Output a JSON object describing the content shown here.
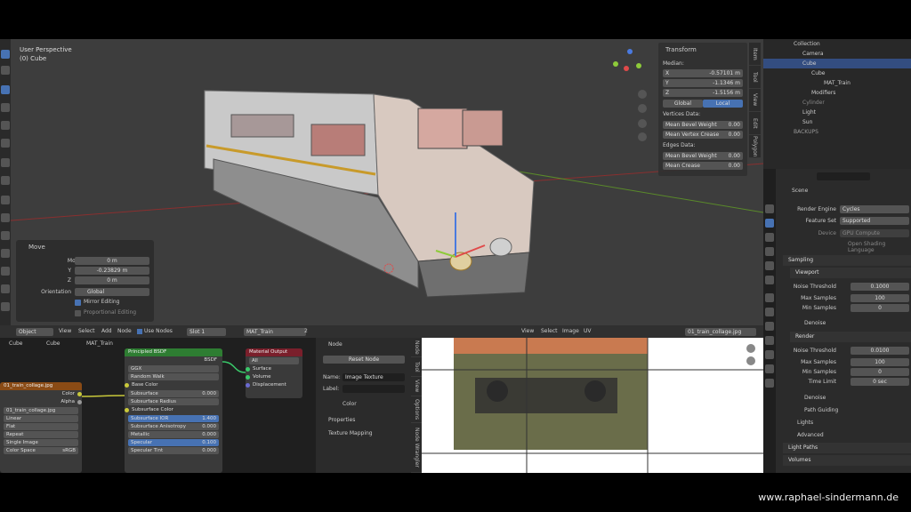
{
  "watermark": "www.raphael-sindermann.de",
  "viewport": {
    "title": "User Perspective",
    "subtitle": "(0) Cube"
  },
  "transform_panel": {
    "title": "Transform",
    "median_label": "Median:",
    "x_label": "X",
    "x_value": "-0.57101 m",
    "y_label": "Y",
    "y_value": "-1.1346 m",
    "z_label": "Z",
    "z_value": "-1.5156 m",
    "global_btn": "Global",
    "local_btn": "Local",
    "vertices_data": "Vertices Data:",
    "mean_bevel_weight_v": "Mean Bevel Weight",
    "mean_bevel_weight_v_val": "0.00",
    "mean_vertex_crease": "Mean Vertex Crease",
    "mean_vertex_crease_val": "0.00",
    "edges_data": "Edges Data:",
    "mean_bevel_weight_e": "Mean Bevel Weight",
    "mean_bevel_weight_e_val": "0.00",
    "mean_crease": "Mean Crease",
    "mean_crease_val": "0.00"
  },
  "npanel_tabs": [
    "Item",
    "Tool",
    "View",
    "Edit",
    "Polygon"
  ],
  "move_panel": {
    "title": "Move",
    "move_x_label": "Move X",
    "move_x": "0 m",
    "y_label": "Y",
    "y": "-0.23829 m",
    "z_label": "Z",
    "z": "0 m",
    "orientation_label": "Orientation",
    "orientation": "Global",
    "mirror_editing": "Mirror Editing",
    "proportional_editing": "Proportional Editing"
  },
  "outliner": {
    "collection": "Collection",
    "camera": "Camera",
    "cube": "Cube",
    "cube_mesh": "Cube",
    "mat_train": "MAT_Train",
    "modifiers": "Modifiers",
    "cylinder": "Cylinder",
    "light": "Light",
    "sun": "Sun",
    "backups": "BACKUPS"
  },
  "properties": {
    "scene": "Scene",
    "render_engine_label": "Render Engine",
    "render_engine": "Cycles",
    "feature_set_label": "Feature Set",
    "feature_set": "Supported",
    "device_label": "Device",
    "device": "GPU Compute",
    "open_shading": "Open Shading Language",
    "sampling": "Sampling",
    "viewport": "Viewport",
    "noise_threshold_label": "Noise Threshold",
    "noise_threshold_vp": "0.1000",
    "max_samples_label": "Max Samples",
    "max_samples_vp": "100",
    "min_samples_label": "Min Samples",
    "min_samples_vp": "0",
    "denoise": "Denoise",
    "render": "Render",
    "noise_threshold_r": "0.0100",
    "max_samples_r": "100",
    "min_samples_r": "0",
    "time_limit_label": "Time Limit",
    "time_limit": "0 sec",
    "denoise_r": "Denoise",
    "path_guiding": "Path Guiding",
    "lights": "Lights",
    "advanced": "Advanced",
    "light_paths": "Light Paths",
    "volumes": "Volumes"
  },
  "node_editor": {
    "header": {
      "object_mode": "Object",
      "view": "View",
      "select": "Select",
      "add": "Add",
      "node": "Node",
      "use_nodes": "Use Nodes",
      "slot": "Slot 1",
      "material": "MAT_Train",
      "users": "2"
    },
    "breadcrumb": [
      "Cube",
      "Cube",
      "MAT_Train"
    ],
    "image_node": {
      "title": "01_train_collage.jpg",
      "color": "Color",
      "alpha": "Alpha",
      "file": "01_train_collage.jpg",
      "linear": "Linear",
      "flat": "Flat",
      "repeat": "Repeat",
      "single_image": "Single Image",
      "color_space_label": "Color Space",
      "color_space": "sRGB"
    },
    "principled": {
      "title": "Principled BSDF",
      "bsdf": "BSDF",
      "distribution": "GGX",
      "subsurface_method": "Random Walk",
      "base_color": "Base Color",
      "subsurface": "Subsurface",
      "subsurface_val": "0.000",
      "subsurface_radius": "Subsurface Radius",
      "subsurface_color": "Subsurface Color",
      "subsurface_ior": "Subsurface IOR",
      "subsurface_ior_val": "1.400",
      "subsurface_aniso": "Subsurface Anisotropy",
      "subsurface_aniso_val": "0.000",
      "metallic": "Metallic",
      "metallic_val": "0.000",
      "specular": "Specular",
      "specular_val": "0.100",
      "specular_tint": "Specular Tint",
      "specular_tint_val": "0.000"
    },
    "output": {
      "title": "Material Output",
      "target": "All",
      "surface": "Surface",
      "volume": "Volume",
      "displacement": "Displacement"
    },
    "side": {
      "node_section": "Node",
      "reset_node": "Reset Node",
      "name_label": "Name:",
      "name": "Image Texture",
      "label_label": "Label:",
      "color": "Color",
      "properties": "Properties",
      "texture_mapping": "Texture Mapping"
    },
    "tabs": [
      "Node",
      "Tool",
      "View",
      "Options",
      "Node Wrangler"
    ]
  },
  "image_editor": {
    "view": "View",
    "select": "Select",
    "image": "Image",
    "uv": "UV",
    "filename": "01_train_collage.jpg"
  },
  "colors": {
    "accent": "#4772b3",
    "principled_header": "#2e7d32",
    "output_header": "#7a1f2b",
    "image_header": "#8a4b15",
    "viewport_bg": "#3d3d3d"
  }
}
